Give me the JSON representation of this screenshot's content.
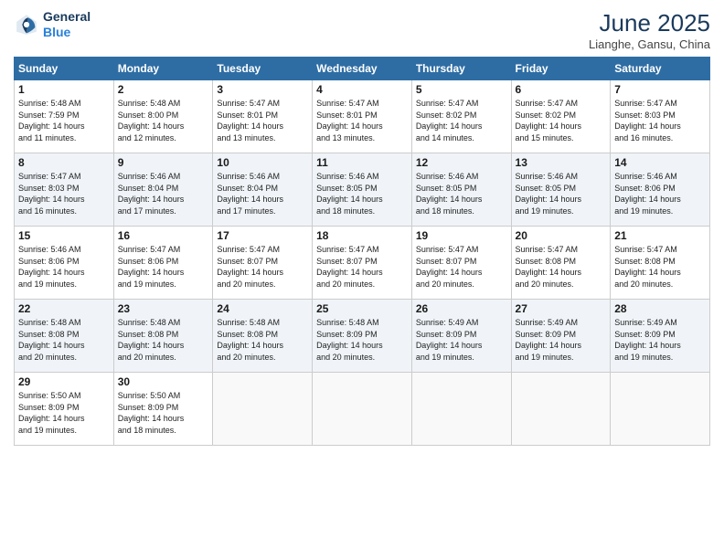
{
  "logo": {
    "line1": "General",
    "line2": "Blue"
  },
  "title": "June 2025",
  "subtitle": "Lianghe, Gansu, China",
  "days_header": [
    "Sunday",
    "Monday",
    "Tuesday",
    "Wednesday",
    "Thursday",
    "Friday",
    "Saturday"
  ],
  "weeks": [
    [
      {
        "day": "1",
        "sunrise": "5:48 AM",
        "sunset": "7:59 PM",
        "daylight": "14 hours and 11 minutes."
      },
      {
        "day": "2",
        "sunrise": "5:48 AM",
        "sunset": "8:00 PM",
        "daylight": "14 hours and 12 minutes."
      },
      {
        "day": "3",
        "sunrise": "5:47 AM",
        "sunset": "8:01 PM",
        "daylight": "14 hours and 13 minutes."
      },
      {
        "day": "4",
        "sunrise": "5:47 AM",
        "sunset": "8:01 PM",
        "daylight": "14 hours and 13 minutes."
      },
      {
        "day": "5",
        "sunrise": "5:47 AM",
        "sunset": "8:02 PM",
        "daylight": "14 hours and 14 minutes."
      },
      {
        "day": "6",
        "sunrise": "5:47 AM",
        "sunset": "8:02 PM",
        "daylight": "14 hours and 15 minutes."
      },
      {
        "day": "7",
        "sunrise": "5:47 AM",
        "sunset": "8:03 PM",
        "daylight": "14 hours and 16 minutes."
      }
    ],
    [
      {
        "day": "8",
        "sunrise": "5:47 AM",
        "sunset": "8:03 PM",
        "daylight": "14 hours and 16 minutes."
      },
      {
        "day": "9",
        "sunrise": "5:46 AM",
        "sunset": "8:04 PM",
        "daylight": "14 hours and 17 minutes."
      },
      {
        "day": "10",
        "sunrise": "5:46 AM",
        "sunset": "8:04 PM",
        "daylight": "14 hours and 17 minutes."
      },
      {
        "day": "11",
        "sunrise": "5:46 AM",
        "sunset": "8:05 PM",
        "daylight": "14 hours and 18 minutes."
      },
      {
        "day": "12",
        "sunrise": "5:46 AM",
        "sunset": "8:05 PM",
        "daylight": "14 hours and 18 minutes."
      },
      {
        "day": "13",
        "sunrise": "5:46 AM",
        "sunset": "8:05 PM",
        "daylight": "14 hours and 19 minutes."
      },
      {
        "day": "14",
        "sunrise": "5:46 AM",
        "sunset": "8:06 PM",
        "daylight": "14 hours and 19 minutes."
      }
    ],
    [
      {
        "day": "15",
        "sunrise": "5:46 AM",
        "sunset": "8:06 PM",
        "daylight": "14 hours and 19 minutes."
      },
      {
        "day": "16",
        "sunrise": "5:47 AM",
        "sunset": "8:06 PM",
        "daylight": "14 hours and 19 minutes."
      },
      {
        "day": "17",
        "sunrise": "5:47 AM",
        "sunset": "8:07 PM",
        "daylight": "14 hours and 20 minutes."
      },
      {
        "day": "18",
        "sunrise": "5:47 AM",
        "sunset": "8:07 PM",
        "daylight": "14 hours and 20 minutes."
      },
      {
        "day": "19",
        "sunrise": "5:47 AM",
        "sunset": "8:07 PM",
        "daylight": "14 hours and 20 minutes."
      },
      {
        "day": "20",
        "sunrise": "5:47 AM",
        "sunset": "8:08 PM",
        "daylight": "14 hours and 20 minutes."
      },
      {
        "day": "21",
        "sunrise": "5:47 AM",
        "sunset": "8:08 PM",
        "daylight": "14 hours and 20 minutes."
      }
    ],
    [
      {
        "day": "22",
        "sunrise": "5:48 AM",
        "sunset": "8:08 PM",
        "daylight": "14 hours and 20 minutes."
      },
      {
        "day": "23",
        "sunrise": "5:48 AM",
        "sunset": "8:08 PM",
        "daylight": "14 hours and 20 minutes."
      },
      {
        "day": "24",
        "sunrise": "5:48 AM",
        "sunset": "8:08 PM",
        "daylight": "14 hours and 20 minutes."
      },
      {
        "day": "25",
        "sunrise": "5:48 AM",
        "sunset": "8:09 PM",
        "daylight": "14 hours and 20 minutes."
      },
      {
        "day": "26",
        "sunrise": "5:49 AM",
        "sunset": "8:09 PM",
        "daylight": "14 hours and 19 minutes."
      },
      {
        "day": "27",
        "sunrise": "5:49 AM",
        "sunset": "8:09 PM",
        "daylight": "14 hours and 19 minutes."
      },
      {
        "day": "28",
        "sunrise": "5:49 AM",
        "sunset": "8:09 PM",
        "daylight": "14 hours and 19 minutes."
      }
    ],
    [
      {
        "day": "29",
        "sunrise": "5:50 AM",
        "sunset": "8:09 PM",
        "daylight": "14 hours and 19 minutes."
      },
      {
        "day": "30",
        "sunrise": "5:50 AM",
        "sunset": "8:09 PM",
        "daylight": "14 hours and 18 minutes."
      },
      null,
      null,
      null,
      null,
      null
    ]
  ]
}
